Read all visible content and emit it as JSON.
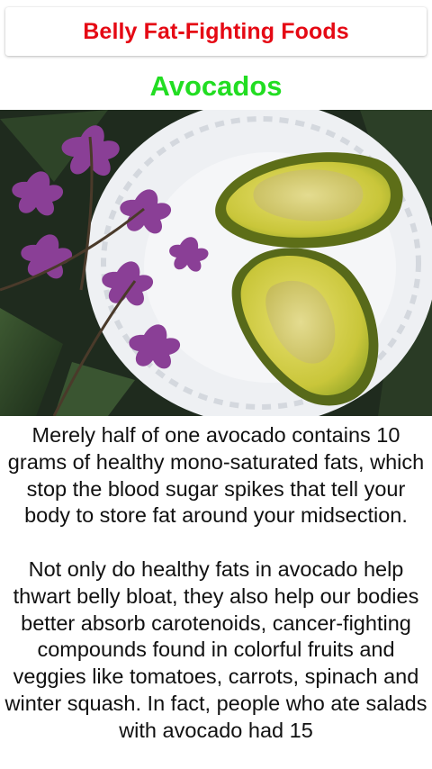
{
  "header": {
    "title": "Belly Fat-Fighting Foods",
    "title_color": "#e50914"
  },
  "section": {
    "heading": "Avocados",
    "heading_color": "#22dd22"
  },
  "image": {
    "subject": "avocado-halves-on-plate-with-orchids"
  },
  "content": {
    "paragraph_1": "Merely half of one avocado contains 10 grams of healthy mono-saturated fats, which stop the blood sugar spikes that tell your body to store fat around your midsection.",
    "paragraph_2": "Not only do healthy fats in avocado help thwart belly bloat, they also help our bodies better absorb carotenoids, cancer-fighting compounds found in colorful fruits and veggies like tomatoes, carrots, spinach and winter squash. In fact, people who ate salads with avocado had 15"
  }
}
